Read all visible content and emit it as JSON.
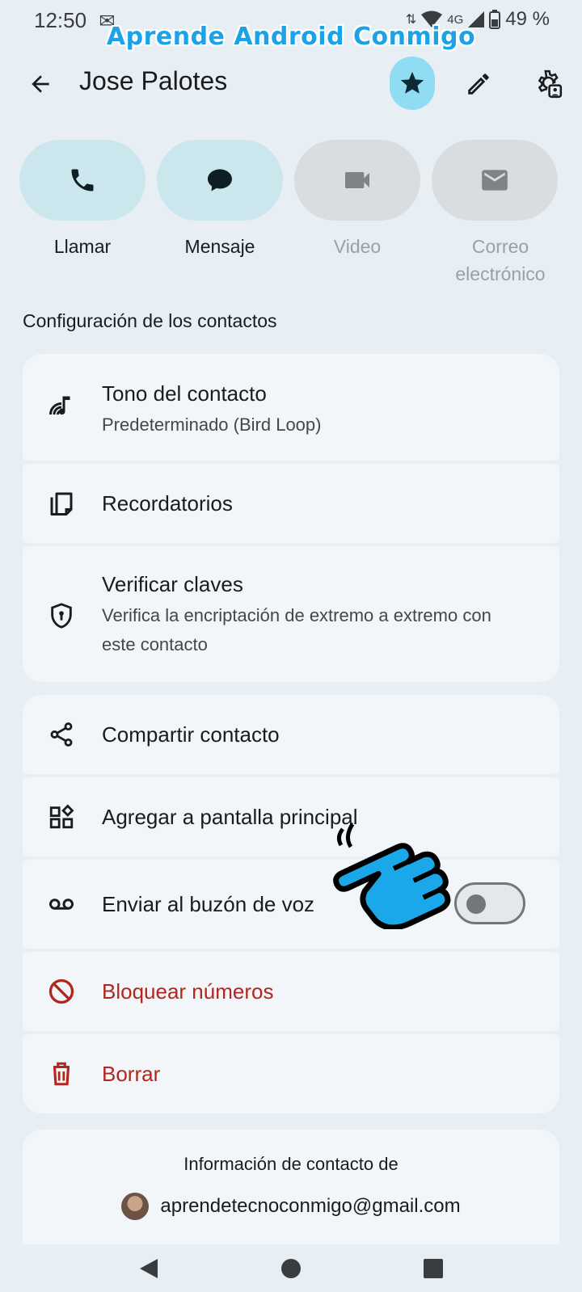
{
  "status_bar": {
    "time": "12:50",
    "network": "4G",
    "battery": "49 %"
  },
  "watermark": "Aprende Android Conmigo",
  "header": {
    "title": "Jose Palotes"
  },
  "actions": [
    {
      "label": "Llamar",
      "icon": "phone-icon",
      "enabled": true
    },
    {
      "label": "Mensaje",
      "icon": "message-icon",
      "enabled": true
    },
    {
      "label": "Video",
      "icon": "video-icon",
      "enabled": false
    },
    {
      "label": "Correo electrónico",
      "icon": "email-icon",
      "enabled": false
    }
  ],
  "section_title": "Configuración de los contactos",
  "settings": {
    "ringtone": {
      "title": "Tono del contacto",
      "subtitle": "Predeterminado (Bird Loop)"
    },
    "reminders": {
      "title": "Recordatorios"
    },
    "verify": {
      "title": "Verificar claves",
      "subtitle": "Verifica la encriptación de extremo a extremo con este contacto"
    }
  },
  "options": {
    "share": "Compartir contacto",
    "add_home": "Agregar a pantalla principal",
    "voicemail": "Enviar al buzón de voz",
    "voicemail_enabled": false,
    "block": "Bloquear números",
    "delete": "Borrar"
  },
  "account": {
    "label": "Información de contacto de",
    "email": "aprendetecnoconmigo@gmail.com"
  },
  "colors": {
    "accent": "#8fdcf3",
    "danger": "#b3261e",
    "background": "#e8eff4"
  }
}
